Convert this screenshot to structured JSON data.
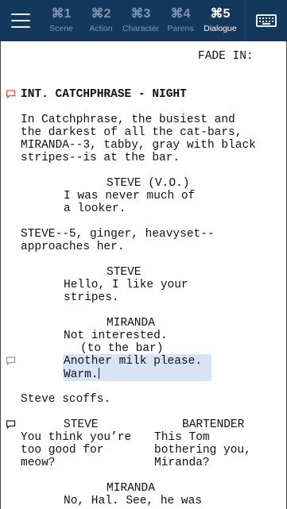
{
  "toolbar": {
    "menu_icon": "hamburger-icon",
    "keyboard_icon": "keyboard-icon",
    "tabs": [
      {
        "key": "⌘1",
        "label": "Scene"
      },
      {
        "key": "⌘2",
        "label": "Action"
      },
      {
        "key": "⌘3",
        "label": "Character"
      },
      {
        "key": "⌘4",
        "label": "Parens"
      },
      {
        "key": "⌘5",
        "label": "Dialogue"
      }
    ],
    "active_tab": "Dialogue"
  },
  "colors": {
    "toolbar_bg": "#14375c",
    "active": "#ffffff",
    "inactive": "#7f96b0",
    "selection": "#d6e4f5",
    "note_icon": "#d9534f"
  },
  "script": {
    "transition": "FADE IN:",
    "scene_heading": "INT. CATCHPHRASE - NIGHT",
    "action1": [
      "In Catchphrase, the busiest and",
      "the darkest of all the cat-bars,",
      "MIRANDA--3, tabby, gray with black",
      "stripes--is at the bar."
    ],
    "char1": "STEVE (V.O.)",
    "dlg1": [
      "I was never much of",
      "a looker."
    ],
    "action2": [
      "STEVE--5, ginger, heavyset--",
      "approaches her."
    ],
    "char2": "STEVE",
    "dlg2": [
      "Hello, I like your",
      "stripes."
    ],
    "char3": "MIRANDA",
    "dlg3a": "Not interested.",
    "paren3": "(to the bar)",
    "dlg3b": [
      "Another milk please.",
      "Warm."
    ],
    "action3": "Steve scoffs.",
    "dual_left_char": "STEVE",
    "dual_left": [
      "You think you’re",
      "too good for",
      "meow?"
    ],
    "dual_right_char": "BARTENDER",
    "dual_right": [
      "This Tom",
      "bothering you,",
      "Miranda?"
    ],
    "char4": "MIRANDA",
    "dlg4": "No, Hal. See, he was"
  }
}
